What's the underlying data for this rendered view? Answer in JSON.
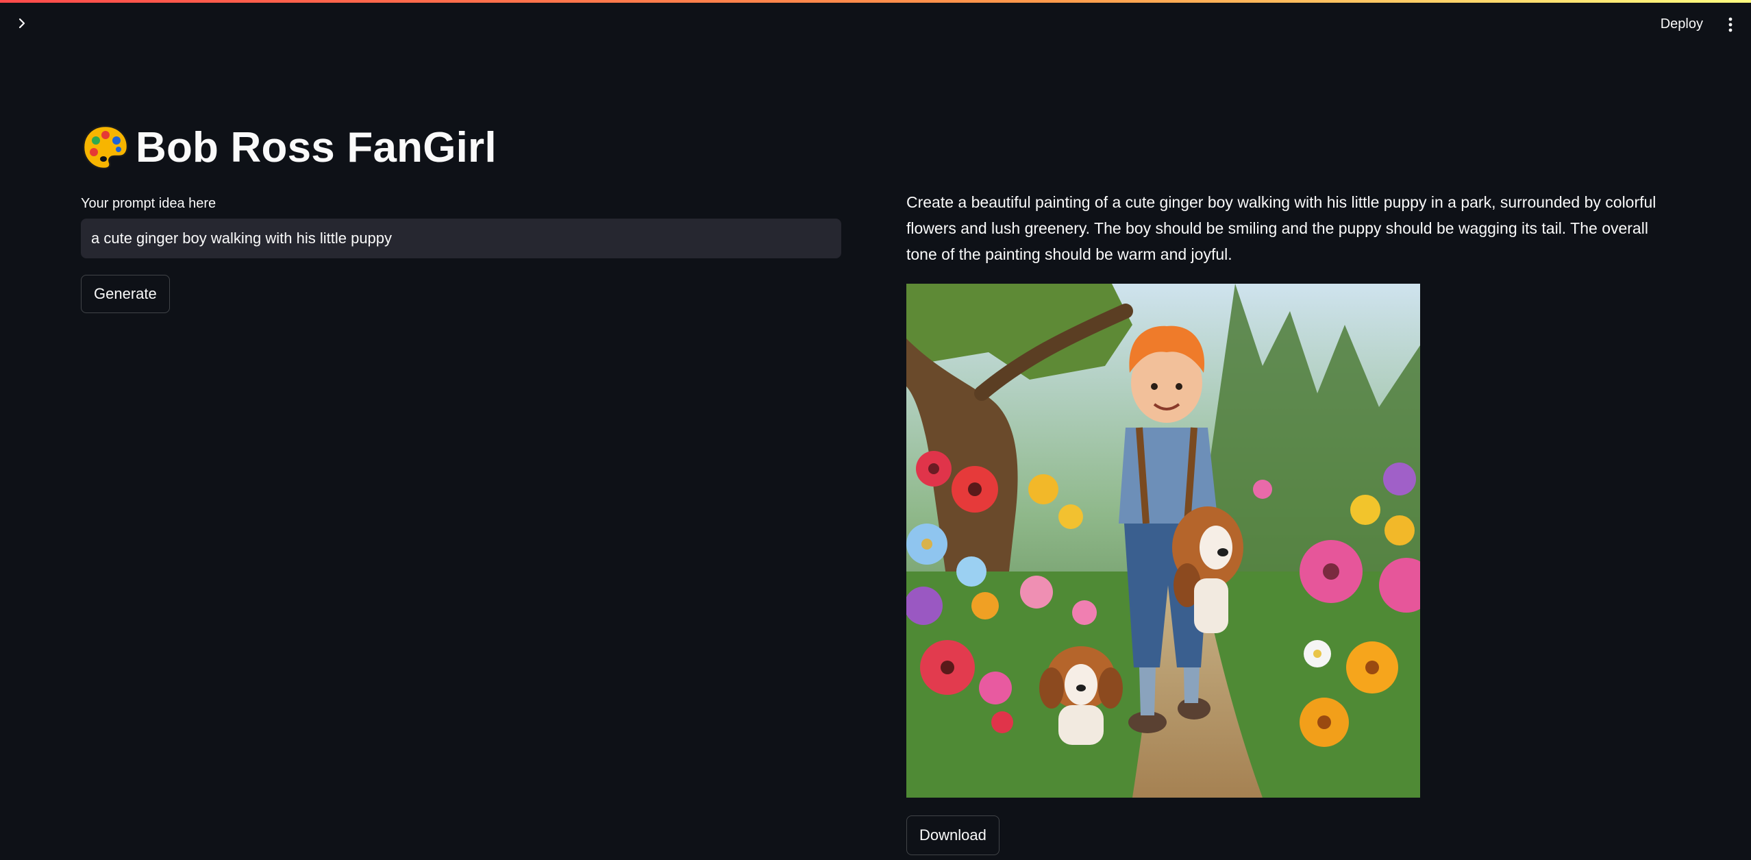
{
  "header": {
    "deploy_label": "Deploy"
  },
  "app": {
    "title": "Bob Ross FanGirl",
    "title_icon": "artist-palette-icon"
  },
  "prompt": {
    "label": "Your prompt idea here",
    "value": "a cute ginger boy walking with his little puppy"
  },
  "buttons": {
    "generate_label": "Generate",
    "download_label": "Download"
  },
  "result": {
    "description": "Create a beautiful painting of a cute ginger boy walking with his little puppy in a park, surrounded by colorful flowers and lush greenery. The boy should be smiling and the puppy should be wagging its tail. The overall tone of the painting should be warm and joyful."
  },
  "colors": {
    "background": "#0e1117",
    "input_bg": "#262730",
    "accent_gradient_start": "#ff4b4b",
    "accent_gradient_end": "#fffd80"
  }
}
